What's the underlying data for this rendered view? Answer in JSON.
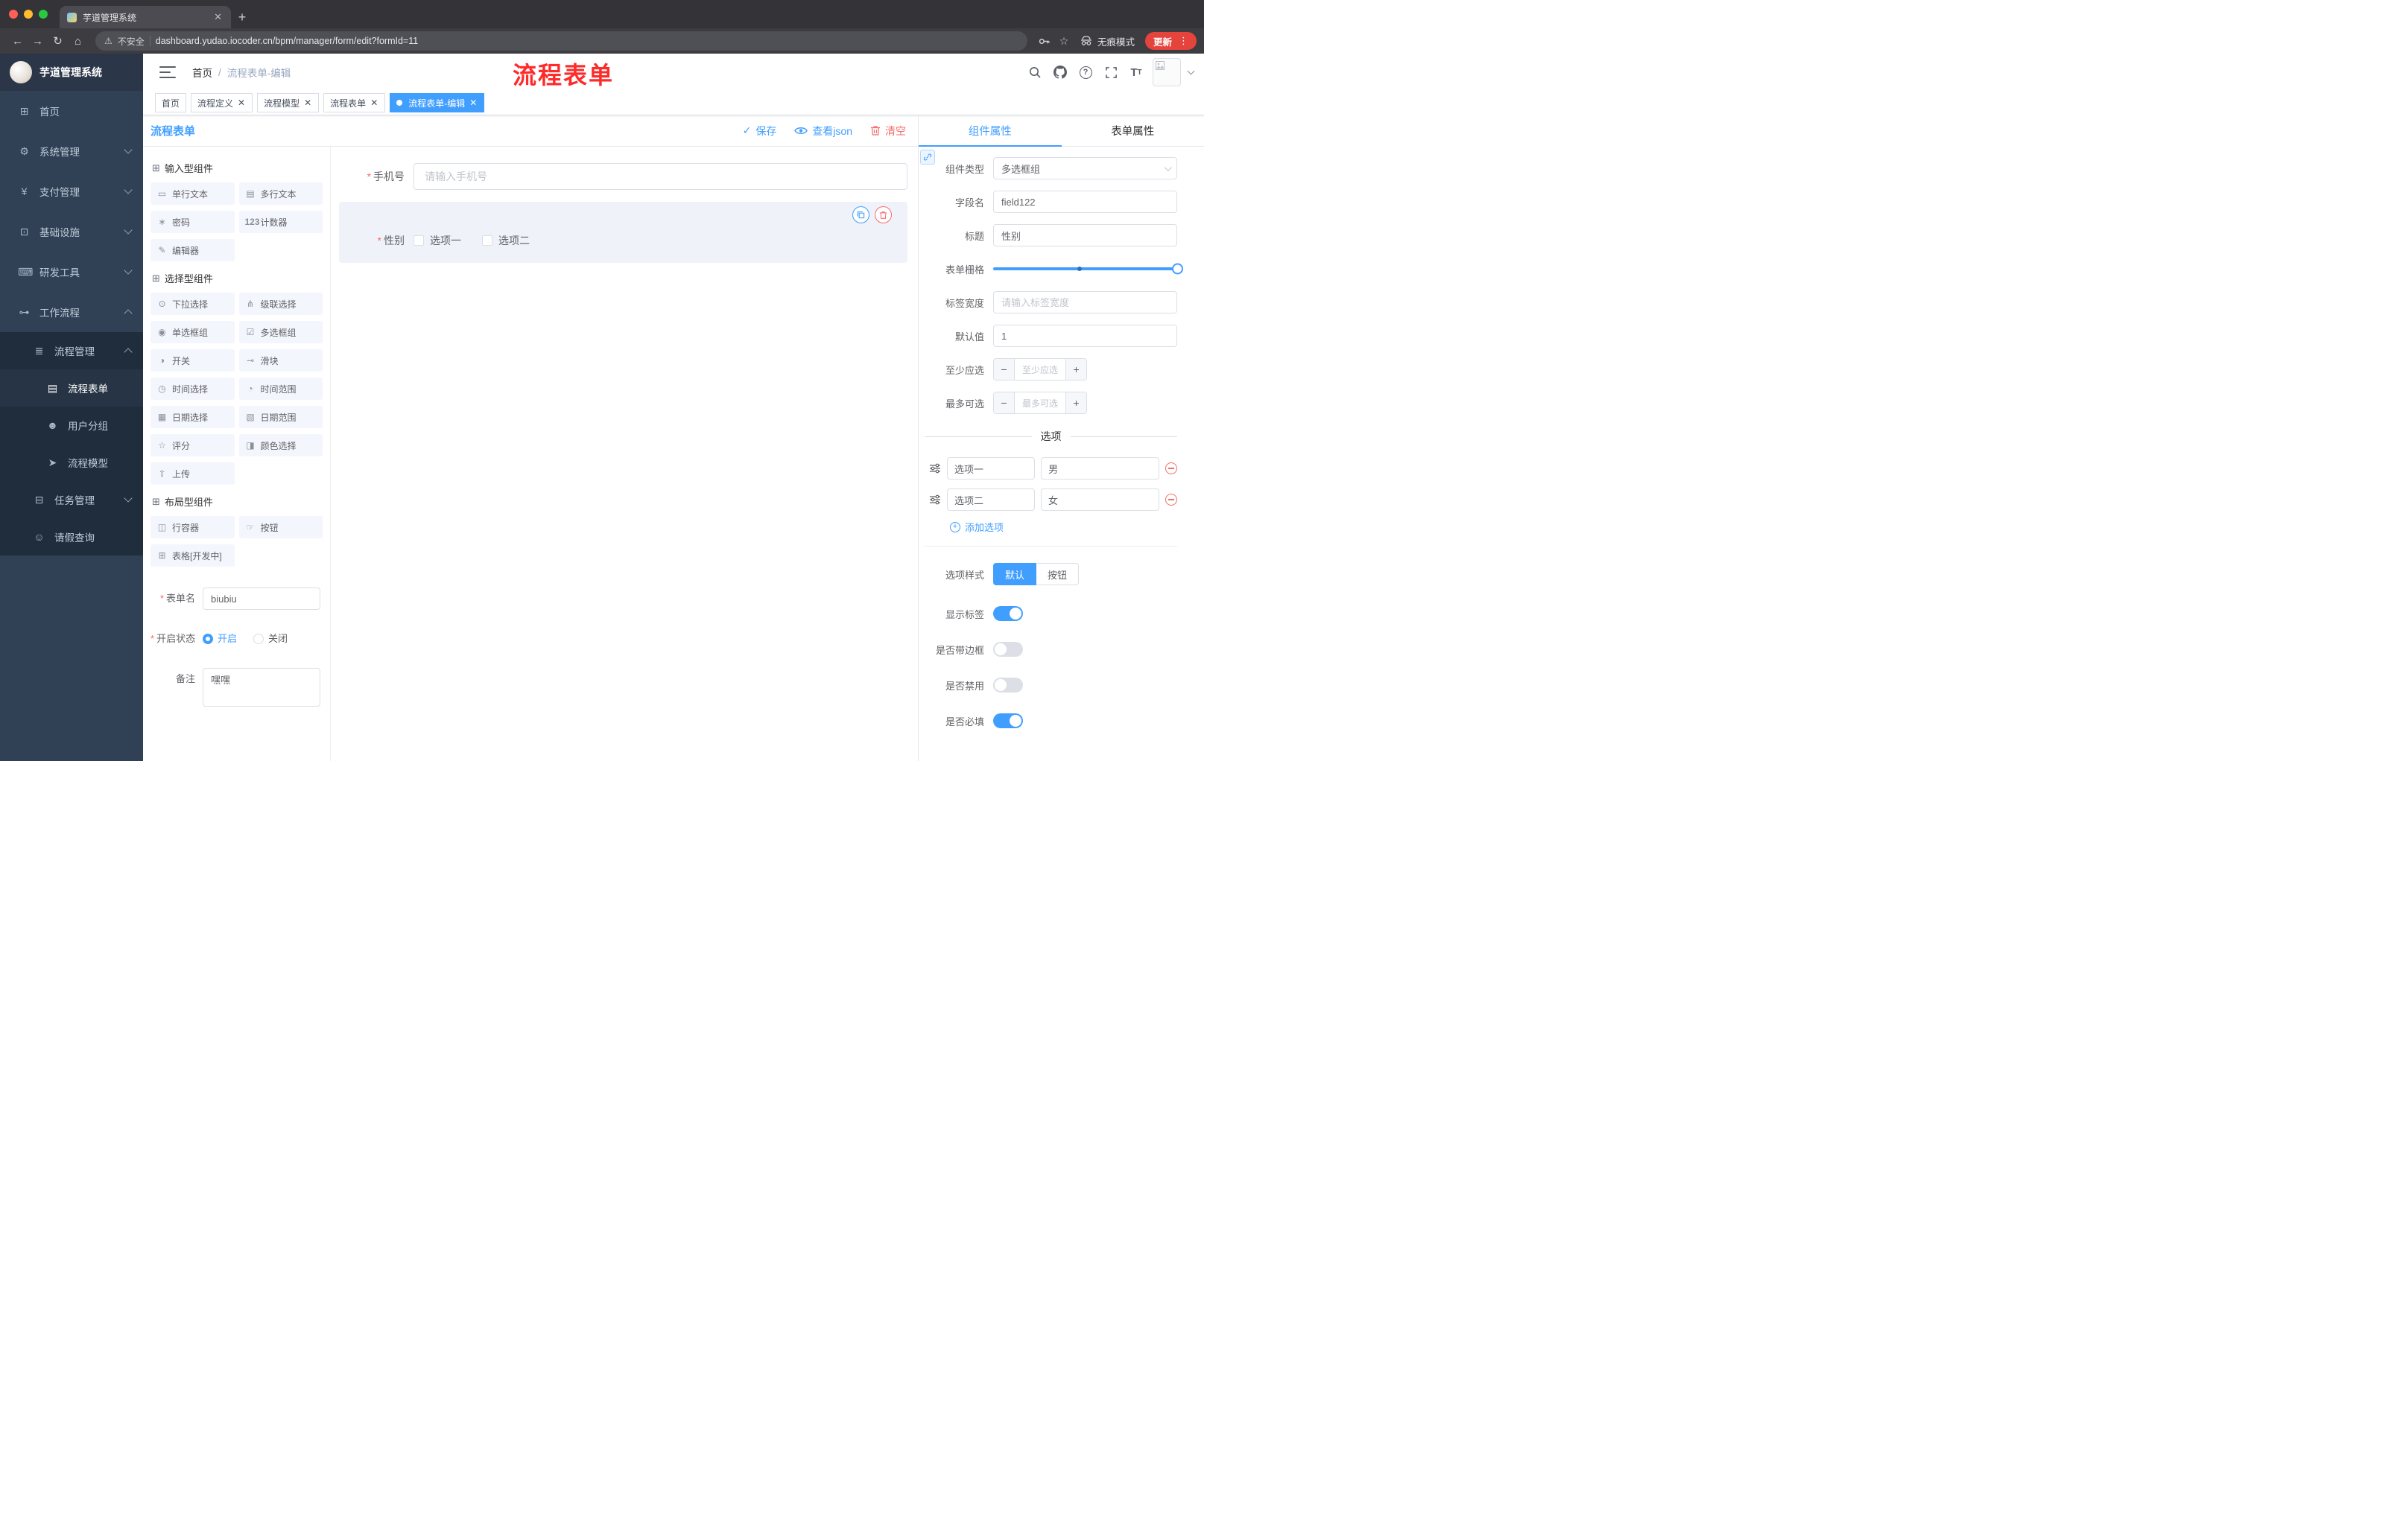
{
  "browser": {
    "tab": {
      "title": "芋道管理系统"
    },
    "security_label": "不安全",
    "url": "dashboard.yudao.iocoder.cn/bpm/manager/form/edit?formId=11",
    "incognito_label": "无痕模式",
    "update_label": "更新"
  },
  "sidebar": {
    "logo_title": "芋道管理系统",
    "items": [
      {
        "label": "首页"
      },
      {
        "label": "系统管理"
      },
      {
        "label": "支付管理"
      },
      {
        "label": "基础设施"
      },
      {
        "label": "研发工具"
      },
      {
        "label": "工作流程"
      },
      {
        "label": "流程管理"
      },
      {
        "label": "流程表单"
      },
      {
        "label": "用户分组"
      },
      {
        "label": "流程模型"
      },
      {
        "label": "任务管理"
      },
      {
        "label": "请假查询"
      }
    ]
  },
  "header": {
    "breadcrumb": {
      "home": "首页",
      "sep": "/",
      "current": "流程表单-编辑"
    },
    "annotation": "流程表单"
  },
  "tags": [
    {
      "label": "首页"
    },
    {
      "label": "流程定义"
    },
    {
      "label": "流程模型"
    },
    {
      "label": "流程表单"
    },
    {
      "label": "流程表单-编辑"
    }
  ],
  "designer": {
    "title": "流程表单",
    "actions": {
      "save": "保存",
      "view_json": "查看json",
      "clear": "清空"
    },
    "groups": [
      {
        "title": "输入型组件",
        "items": [
          "单行文本",
          "多行文本",
          "密码",
          "计数器",
          "编辑器"
        ]
      },
      {
        "title": "选择型组件",
        "items": [
          "下拉选择",
          "级联选择",
          "单选框组",
          "多选框组",
          "开关",
          "滑块",
          "时间选择",
          "时间范围",
          "日期选择",
          "日期范围",
          "评分",
          "颜色选择",
          "上传"
        ]
      },
      {
        "title": "布局型组件",
        "items": [
          "行容器",
          "按钮",
          "表格[开发中]"
        ]
      }
    ],
    "form": {
      "name_label": "表单名",
      "name_value": "biubiu",
      "status_label": "开启状态",
      "status_on": "开启",
      "status_off": "关闭",
      "remark_label": "备注",
      "remark_value": "嘿嘿"
    },
    "canvas": {
      "phone_label": "手机号",
      "phone_placeholder": "请输入手机号",
      "gender_label": "性别",
      "gender_options": [
        "选项一",
        "选项二"
      ]
    }
  },
  "props": {
    "tabs": {
      "component": "组件属性",
      "form": "表单属性"
    },
    "fields": {
      "type_label": "组件类型",
      "type_value": "多选框组",
      "field_label": "字段名",
      "field_value": "field122",
      "title_label": "标题",
      "title_value": "性别",
      "grid_label": "表单栅格",
      "label_width_label": "标签宽度",
      "label_width_placeholder": "请输入标签宽度",
      "default_label": "默认值",
      "default_value": "1",
      "min_label": "至少应选",
      "min_placeholder": "至少应选",
      "max_label": "最多可选",
      "max_placeholder": "最多可选"
    },
    "options_divider": "选项",
    "options": [
      {
        "label": "选项一",
        "value": "男"
      },
      {
        "label": "选项二",
        "value": "女"
      }
    ],
    "add_option": "添加选项",
    "style_label": "选项样式",
    "style_default": "默认",
    "style_button": "按钮",
    "switches": [
      {
        "label": "显示标签"
      },
      {
        "label": "是否带边框"
      },
      {
        "label": "是否禁用"
      },
      {
        "label": "是否必填"
      }
    ]
  },
  "colors": {
    "primary": "#409EFF",
    "danger": "#F56C6C",
    "annotation": "#FF2A2A"
  }
}
